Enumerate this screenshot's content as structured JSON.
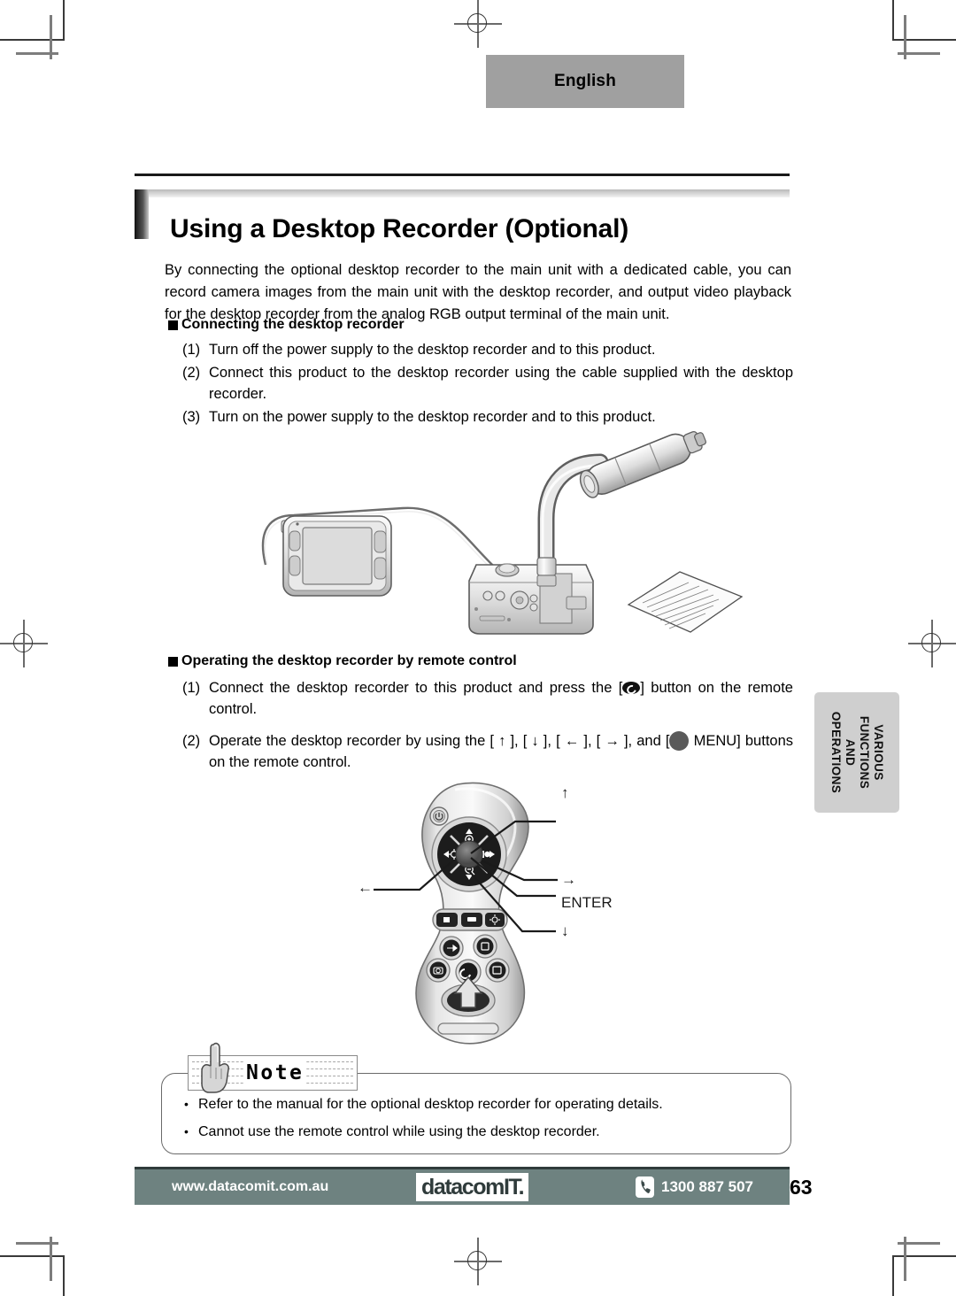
{
  "header": {
    "language_label": "English"
  },
  "title": "Using a Desktop Recorder (Optional)",
  "intro": "By connecting the optional desktop recorder to the main unit with a dedicated cable, you can record camera images from the main unit with the desktop recorder, and output video playback for the desktop recorder from the analog RGB output terminal of the main unit.",
  "sections": [
    {
      "heading": "Connecting the desktop recorder",
      "steps": [
        {
          "num": "(1)",
          "text": "Turn off the power supply to the desktop recorder and to this product."
        },
        {
          "num": "(2)",
          "text": "Connect this product to the desktop recorder using the cable supplied with the desktop recorder."
        },
        {
          "num": "(3)",
          "text": "Turn on the power supply to the desktop recorder and to this product."
        }
      ]
    },
    {
      "heading": "Operating the desktop recorder by remote control",
      "steps": [
        {
          "num": "(1)",
          "text_before": "Connect the desktop recorder to this product and press the [",
          "text_after": "] button on the remote control."
        },
        {
          "num": "(2)",
          "text_before": "Operate the desktop recorder by using the [ ↑ ], [ ↓ ], [ ← ], [ → ], and [",
          "text_after": " MENU] buttons on the remote control."
        }
      ]
    }
  ],
  "side_tab": {
    "line1": "VARIOUS",
    "line2": "FUNCTIONS",
    "line3": "AND",
    "line4": "OPERATIONS"
  },
  "remote_callouts": {
    "up": "↑",
    "right": "→",
    "enter": "ENTER",
    "down": "↓",
    "left": "←"
  },
  "note": {
    "badge_label": "Note",
    "items": [
      "Refer to the manual for the optional desktop recorder for operating details.",
      "Cannot use the remote control while using the desktop recorder."
    ],
    "bullet": "•"
  },
  "footer": {
    "url": "www.datacomit.com.au",
    "logo": "datacomIT.",
    "phone": "1300 887 507",
    "page_number": "63"
  },
  "colors": {
    "lang_box": "#a0a0a0",
    "footer_bar": "#6e8280",
    "side_tab": "#cfcfcf",
    "title_rule": "#1a1a1a"
  }
}
